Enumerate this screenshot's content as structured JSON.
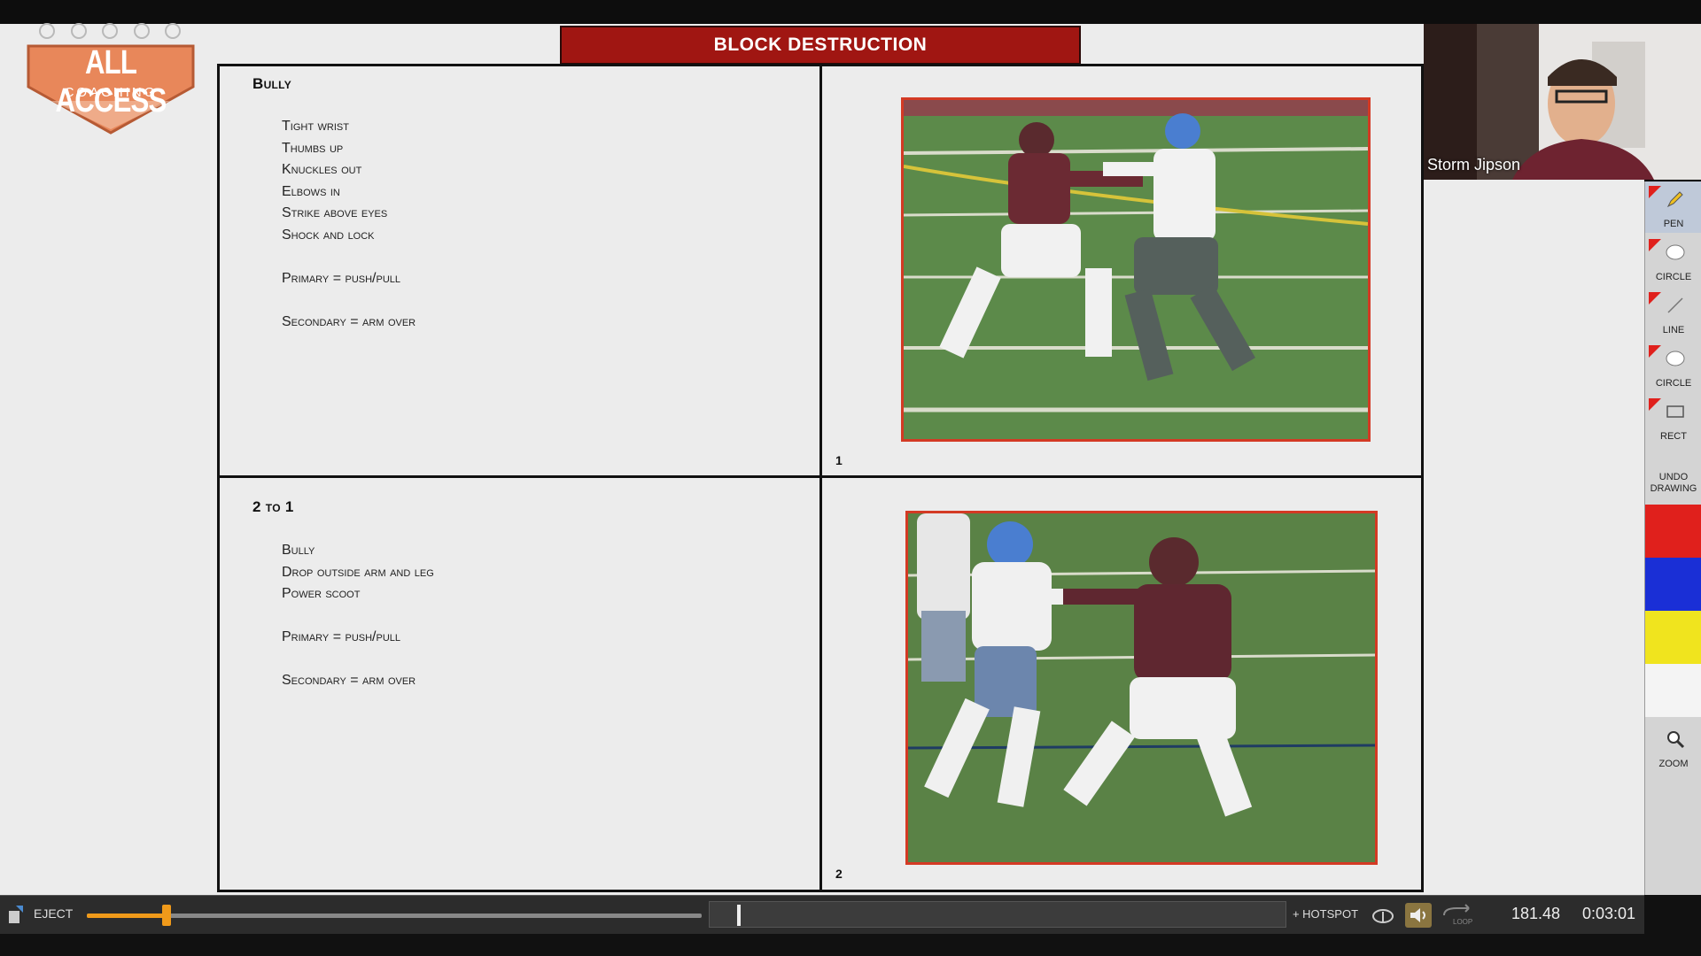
{
  "logo": {
    "line1": "ALL ACCESS",
    "line2": "COACHING",
    "accent": "#e8875a"
  },
  "banner": {
    "title": "BLOCK DESTRUCTION",
    "color": "#a01612"
  },
  "cells": [
    {
      "title": "Bully",
      "items": [
        "Tight wrist",
        "Thumbs up",
        "Knuckles out",
        "Elbows in",
        "Strike above eyes",
        "Shock and lock",
        "",
        "Primary = push/pull",
        "",
        "Secondary = arm over"
      ],
      "number": "1"
    },
    {
      "title": "2 to 1",
      "items": [
        "Bully",
        "Drop outside arm and leg",
        "Power scoot",
        "",
        "Primary = push/pull",
        "",
        "Secondary = arm over"
      ],
      "number": "2"
    }
  ],
  "webcam": {
    "name": "Storm Jipson"
  },
  "tools": [
    {
      "label": "PEN",
      "icon": "pencil-icon",
      "active": true
    },
    {
      "label": "CIRCLE",
      "icon": "filled-circle-icon"
    },
    {
      "label": "LINE",
      "icon": "line-icon"
    },
    {
      "label": "CIRCLE",
      "icon": "filled-circle-icon"
    },
    {
      "label": "RECT",
      "icon": "rectangle-icon"
    }
  ],
  "undo": {
    "line1": "UNDO",
    "line2": "DRAWING"
  },
  "swatches": [
    "#e0201c",
    "#1a2fd6",
    "#f0e41e",
    "#f4f4f4"
  ],
  "zoom": {
    "label": "ZOOM",
    "icon": "magnifier-icon"
  },
  "player": {
    "eject_label": "EJECT",
    "progress": 0.13,
    "hotspot_label": "+ HOTSPOT",
    "loop_label": "LOOP",
    "frame_value": "181.48",
    "time_value": "0:03:01"
  }
}
